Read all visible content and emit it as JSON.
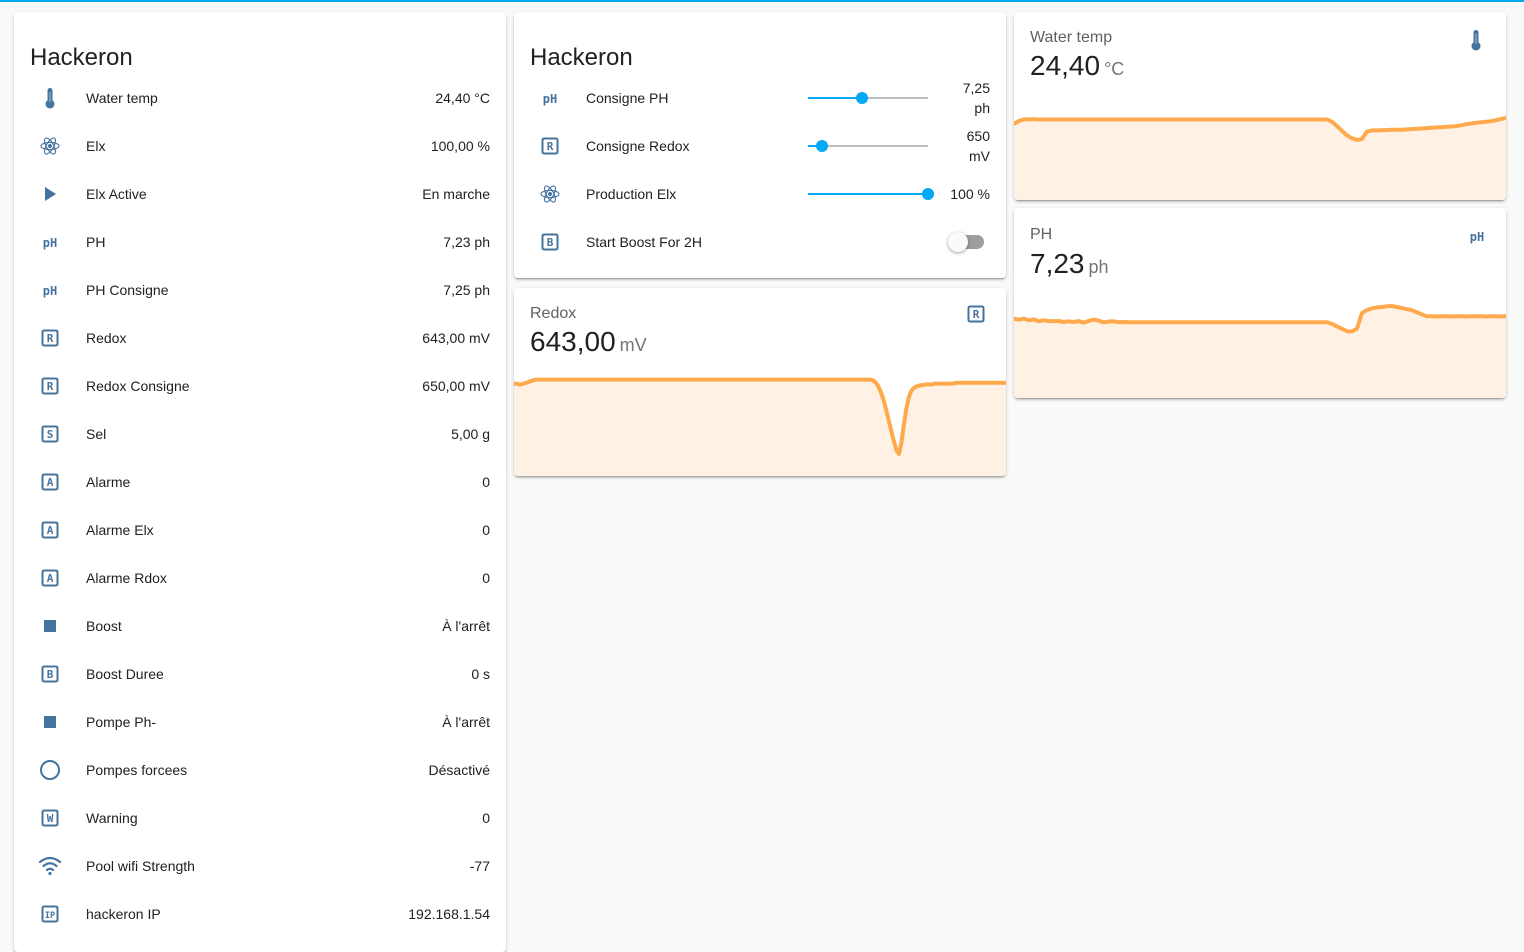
{
  "colors": {
    "accent": "#03a9f4",
    "icon": "#44739e",
    "graph_line": "#ffa94d",
    "graph_fill": "#fff1e4"
  },
  "entities_card": {
    "title": "Hackeron",
    "rows": [
      {
        "icon": "thermometer-icon",
        "name": "Water temp",
        "state": "24,40 °C"
      },
      {
        "icon": "atom-icon",
        "name": "Elx",
        "state": "100,00 %"
      },
      {
        "icon": "play-icon",
        "name": "Elx Active",
        "state": "En marche"
      },
      {
        "icon": "ph-icon",
        "name": "PH",
        "state": "7,23 ph"
      },
      {
        "icon": "ph-icon",
        "name": "PH Consigne",
        "state": "7,25 ph"
      },
      {
        "icon": "letter-r-box-icon",
        "name": "Redox",
        "state": "643,00 mV"
      },
      {
        "icon": "letter-r-box-icon",
        "name": "Redox Consigne",
        "state": "650,00 mV"
      },
      {
        "icon": "letter-s-box-icon",
        "name": "Sel",
        "state": "5,00 g"
      },
      {
        "icon": "letter-a-box-icon",
        "name": "Alarme",
        "state": "0"
      },
      {
        "icon": "letter-a-box-icon",
        "name": "Alarme Elx",
        "state": "0"
      },
      {
        "icon": "letter-a-box-icon",
        "name": "Alarme Rdox",
        "state": "0"
      },
      {
        "icon": "stop-icon",
        "name": "Boost",
        "state": "À l'arrêt"
      },
      {
        "icon": "letter-b-box-icon",
        "name": "Boost Duree",
        "state": "0 s"
      },
      {
        "icon": "stop-icon",
        "name": "Pompe Ph-",
        "state": "À l'arrêt"
      },
      {
        "icon": "circle-outline-icon",
        "name": "Pompes forcees",
        "state": "Désactivé"
      },
      {
        "icon": "letter-w-box-icon",
        "name": "Warning",
        "state": "0"
      },
      {
        "icon": "wifi-icon",
        "name": "Pool wifi Strength",
        "state": "-77"
      },
      {
        "icon": "ip-box-icon",
        "name": "hackeron IP",
        "state": "192.168.1.54"
      }
    ]
  },
  "controls_card": {
    "title": "Hackeron",
    "rows": [
      {
        "icon": "ph-icon",
        "name": "Consigne PH",
        "type": "slider",
        "level": 0.45,
        "value_line1": "7,25",
        "value_line2": "ph"
      },
      {
        "icon": "letter-r-box-icon",
        "name": "Consigne Redox",
        "type": "slider",
        "level": 0.12,
        "value_line1": "650",
        "value_line2": "mV"
      },
      {
        "icon": "atom-icon",
        "name": "Production Elx",
        "type": "slider",
        "level": 1.0,
        "value_line1": "100 %",
        "value_line2": ""
      },
      {
        "icon": "letter-b-box-icon",
        "name": "Start Boost For 2H",
        "type": "toggle",
        "on": false
      }
    ]
  },
  "sensor_cards": {
    "water_temp": {
      "name": "Water temp",
      "value": "24,40",
      "unit": "°C",
      "icon": "thermometer-icon",
      "trend": [
        0.49,
        0.58,
        0.62,
        0.63,
        0.63,
        0.62,
        0.62,
        0.62,
        0.62,
        0.62,
        0.62,
        0.62,
        0.62,
        0.62,
        0.62,
        0.62,
        0.62,
        0.62,
        0.62,
        0.62,
        0.62,
        0.62,
        0.62,
        0.62,
        0.62,
        0.62,
        0.62,
        0.62,
        0.62,
        0.62,
        0.62,
        0.62,
        0.62,
        0.62,
        0.62,
        0.62,
        0.62,
        0.62,
        0.62,
        0.62,
        0.62,
        0.62,
        0.62,
        0.62,
        0.62,
        0.62,
        0.62,
        0.62,
        0.62,
        0.62,
        0.62,
        0.62,
        0.62,
        0.62,
        0.62,
        0.62,
        0.62,
        0.62,
        0.62,
        0.62,
        0.62,
        0.62,
        0.62,
        0.62,
        0.55,
        0.42,
        0.28,
        0.14,
        0.05,
        0.0,
        0.03,
        0.25,
        0.29,
        0.29,
        0.3,
        0.3,
        0.31,
        0.31,
        0.31,
        0.32,
        0.33,
        0.34,
        0.35,
        0.36,
        0.37,
        0.38,
        0.39,
        0.4,
        0.41,
        0.42,
        0.45,
        0.48,
        0.5,
        0.52,
        0.54,
        0.55,
        0.57,
        0.6,
        0.64,
        0.67
      ]
    },
    "ph": {
      "name": "PH",
      "value": "7,23",
      "unit": "ph",
      "icon": "ph-icon",
      "trend": [
        0.62,
        0.6,
        0.63,
        0.58,
        0.61,
        0.55,
        0.58,
        0.56,
        0.55,
        0.56,
        0.53,
        0.55,
        0.53,
        0.56,
        0.51,
        0.56,
        0.6,
        0.57,
        0.52,
        0.54,
        0.55,
        0.52,
        0.53,
        0.52,
        0.52,
        0.52,
        0.52,
        0.52,
        0.52,
        0.52,
        0.52,
        0.52,
        0.52,
        0.52,
        0.52,
        0.52,
        0.52,
        0.52,
        0.52,
        0.52,
        0.52,
        0.52,
        0.52,
        0.52,
        0.52,
        0.52,
        0.52,
        0.52,
        0.52,
        0.52,
        0.52,
        0.52,
        0.52,
        0.52,
        0.52,
        0.52,
        0.52,
        0.52,
        0.52,
        0.52,
        0.52,
        0.52,
        0.52,
        0.52,
        0.47,
        0.4,
        0.33,
        0.26,
        0.25,
        0.33,
        0.79,
        0.88,
        0.93,
        0.96,
        0.97,
        0.99,
        1.0,
        0.97,
        0.94,
        0.91,
        0.88,
        0.82,
        0.76,
        0.7,
        0.7,
        0.69,
        0.7,
        0.7,
        0.69,
        0.7,
        0.7,
        0.69,
        0.7,
        0.7,
        0.7,
        0.69,
        0.7,
        0.7,
        0.69,
        0.7
      ]
    },
    "redox": {
      "name": "Redox",
      "value": "643,00",
      "unit": "mV",
      "icon": "letter-r-box-icon",
      "trend": [
        0.88,
        0.88,
        0.87,
        0.87,
        0.88,
        0.89,
        0.9,
        0.91,
        0.92,
        0.93,
        0.93,
        0.93,
        0.93,
        0.93,
        0.93,
        0.93,
        0.93,
        0.93,
        0.93,
        0.93,
        0.93,
        0.93,
        0.93,
        0.93,
        0.93,
        0.93,
        0.93,
        0.93,
        0.93,
        0.93,
        0.93,
        0.93,
        0.93,
        0.93,
        0.93,
        0.93,
        0.93,
        0.93,
        0.93,
        0.93,
        0.93,
        0.93,
        0.93,
        0.93,
        0.93,
        0.93,
        0.93,
        0.93,
        0.93,
        0.93,
        0.93,
        0.93,
        0.93,
        0.93,
        0.93,
        0.93,
        0.93,
        0.93,
        0.93,
        0.93,
        0.93,
        0.93,
        0.93,
        0.93,
        0.93,
        0.93,
        0.93,
        0.93,
        0.93,
        0.93,
        0.93,
        0.93,
        0.93,
        0.93,
        0.93,
        0.93,
        0.93,
        0.93,
        0.93,
        0.93,
        0.93,
        0.93,
        0.93,
        0.93,
        0.93,
        0.93,
        0.93,
        0.93,
        0.93,
        0.93,
        0.93,
        0.93,
        0.93,
        0.93,
        0.93,
        0.93,
        0.93,
        0.93,
        0.93,
        0.93,
        0.93,
        0.93,
        0.93,
        0.93,
        0.93,
        0.93,
        0.93,
        0.93,
        0.93,
        0.93,
        0.93,
        0.93,
        0.93,
        0.93,
        0.93,
        0.93,
        0.93,
        0.93,
        0.93,
        0.93,
        0.93,
        0.93,
        0.93,
        0.93,
        0.93,
        0.93,
        0.93,
        0.93,
        0.93,
        0.93,
        0.93,
        0.93,
        0.93,
        0.93,
        0.93,
        0.93,
        0.93,
        0.93,
        0.93,
        0.93,
        0.93,
        0.93,
        0.93,
        0.93,
        0.93,
        0.93,
        0.93,
        0.93,
        0.93,
        0.93,
        0.93,
        0.92,
        0.9,
        0.86,
        0.8,
        0.72,
        0.62,
        0.5,
        0.38,
        0.26,
        0.14,
        0.04,
        0.0,
        0.14,
        0.36,
        0.56,
        0.7,
        0.78,
        0.82,
        0.84,
        0.85,
        0.86,
        0.86,
        0.87,
        0.87,
        0.87,
        0.87,
        0.88,
        0.88,
        0.88,
        0.88,
        0.88,
        0.88,
        0.88,
        0.88,
        0.88,
        0.89,
        0.89,
        0.89,
        0.89,
        0.89,
        0.89,
        0.89,
        0.89,
        0.89,
        0.89,
        0.89,
        0.89,
        0.89,
        0.89,
        0.89,
        0.89,
        0.89,
        0.89,
        0.89,
        0.89,
        0.89,
        0.89
      ]
    }
  }
}
